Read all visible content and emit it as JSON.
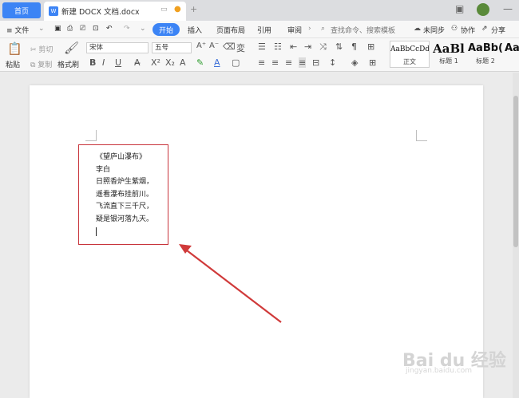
{
  "tabs": {
    "home_label": "首页",
    "doc_title": "新建 DOCX 文档.docx",
    "doc_icon_text": "W"
  },
  "menu": {
    "file_label": "≡ 文件",
    "items": [
      "开始",
      "插入",
      "页面布局",
      "引用",
      "审阅"
    ],
    "search_placeholder": "查找命令、搜索模板",
    "sync_label": "未同步",
    "collab_label": "协作",
    "share_label": "分享"
  },
  "ribbon": {
    "paste_label": "粘贴",
    "cut_label": "剪切",
    "copy_label": "复制",
    "format_painter_label": "格式刷",
    "font_name": "宋体",
    "font_size": "五号",
    "styles": [
      {
        "preview": "AaBbCcDd",
        "label": "正文"
      },
      {
        "preview": "AaBl",
        "label": "标题 1"
      },
      {
        "preview": "AaBb(",
        "label": "标题 2"
      },
      {
        "preview": "AaB",
        "label": ""
      }
    ]
  },
  "document": {
    "poem_title": "《望庐山瀑布》",
    "author": "李白",
    "lines": [
      "日照香炉生紫烟，",
      "遥看瀑布挂前川。",
      "飞流直下三千尺，",
      "疑是银河落九天。"
    ]
  },
  "watermark": {
    "brand": "Bai du 经验",
    "url": "jingyan.baidu.com"
  },
  "colors": {
    "accent": "#3c84f5",
    "highlight_box": "#c8343b",
    "arrow": "#d03a3a"
  }
}
